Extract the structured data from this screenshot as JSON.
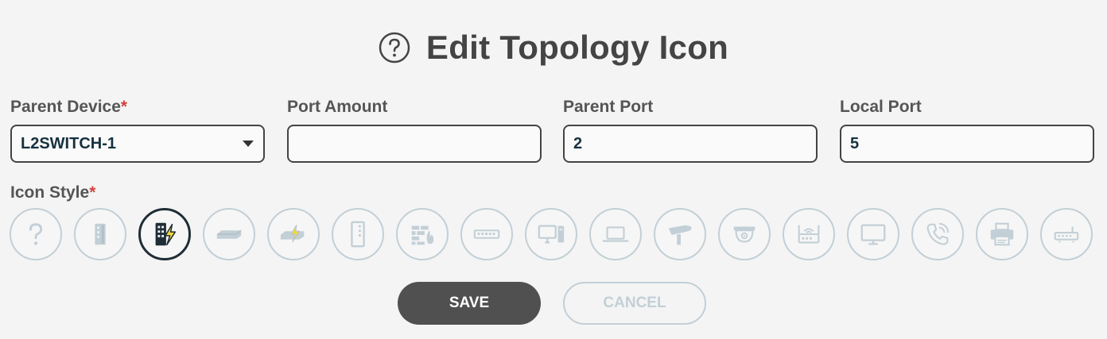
{
  "dialog": {
    "title": "Edit Topology Icon"
  },
  "fields": {
    "parent_device": {
      "label": "Parent Device",
      "required_mark": "*",
      "value": "L2SWITCH-1"
    },
    "port_amount": {
      "label": "Port Amount",
      "value": ""
    },
    "parent_port": {
      "label": "Parent Port",
      "value": "2"
    },
    "local_port": {
      "label": "Local Port",
      "value": "5"
    }
  },
  "icon_style": {
    "label": "Icon Style",
    "required_mark": "*",
    "selected": "managed-switch-poe-icon",
    "options": [
      "unknown-device-icon",
      "unmanaged-switch-icon",
      "managed-switch-poe-icon",
      "rack-switch-icon",
      "rack-switch-poe-icon",
      "industrial-switch-icon",
      "firewall-icon",
      "desktop-switch-icon",
      "desktop-computer-icon",
      "laptop-icon",
      "bullet-camera-icon",
      "dome-camera-icon",
      "wireless-access-point-icon",
      "monitor-icon",
      "voip-phone-icon",
      "printer-icon",
      "router-icon"
    ]
  },
  "buttons": {
    "save": "SAVE",
    "cancel": "CANCEL"
  },
  "colors": {
    "required": "#d0443f",
    "icon_inactive": "#c3cfd6",
    "icon_selected_border": "#1f2e36",
    "poe_bolt": "#f0d83a",
    "save_bg": "#505050"
  }
}
